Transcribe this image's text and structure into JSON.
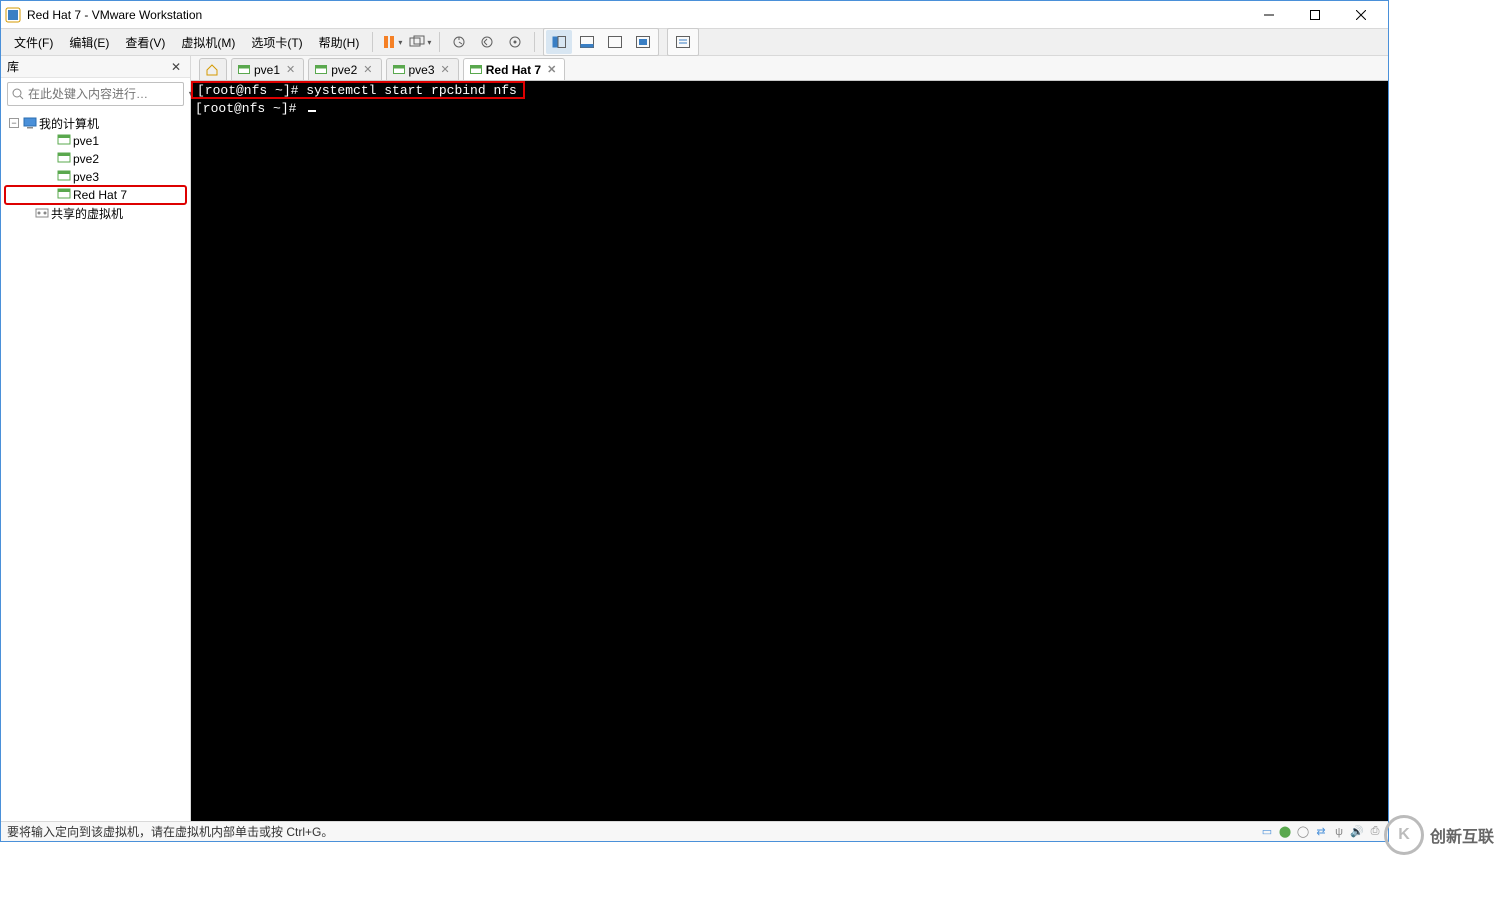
{
  "titlebar": {
    "title": "Red Hat 7 - VMware Workstation"
  },
  "menu": {
    "file": "文件(F)",
    "edit": "编辑(E)",
    "view": "查看(V)",
    "vm": "虚拟机(M)",
    "tabs": "选项卡(T)",
    "help": "帮助(H)"
  },
  "sidebar": {
    "title": "库",
    "search_placeholder": "在此处键入内容进行…",
    "root": "我的计算机",
    "items": [
      "pve1",
      "pve2",
      "pve3",
      "Red Hat 7"
    ],
    "shared": "共享的虚拟机"
  },
  "tabs": [
    {
      "label": "pve1",
      "active": false
    },
    {
      "label": "pve2",
      "active": false
    },
    {
      "label": "pve3",
      "active": false
    },
    {
      "label": "Red Hat 7",
      "active": true
    }
  ],
  "terminal": {
    "line1": "[root@nfs ~]# systemctl start rpcbind nfs",
    "line2": "[root@nfs ~]# "
  },
  "statusbar": {
    "text": "要将输入定向到该虚拟机，请在虚拟机内部单击或按 Ctrl+G。"
  },
  "watermark": {
    "mark": "K",
    "text": "创新互联"
  }
}
